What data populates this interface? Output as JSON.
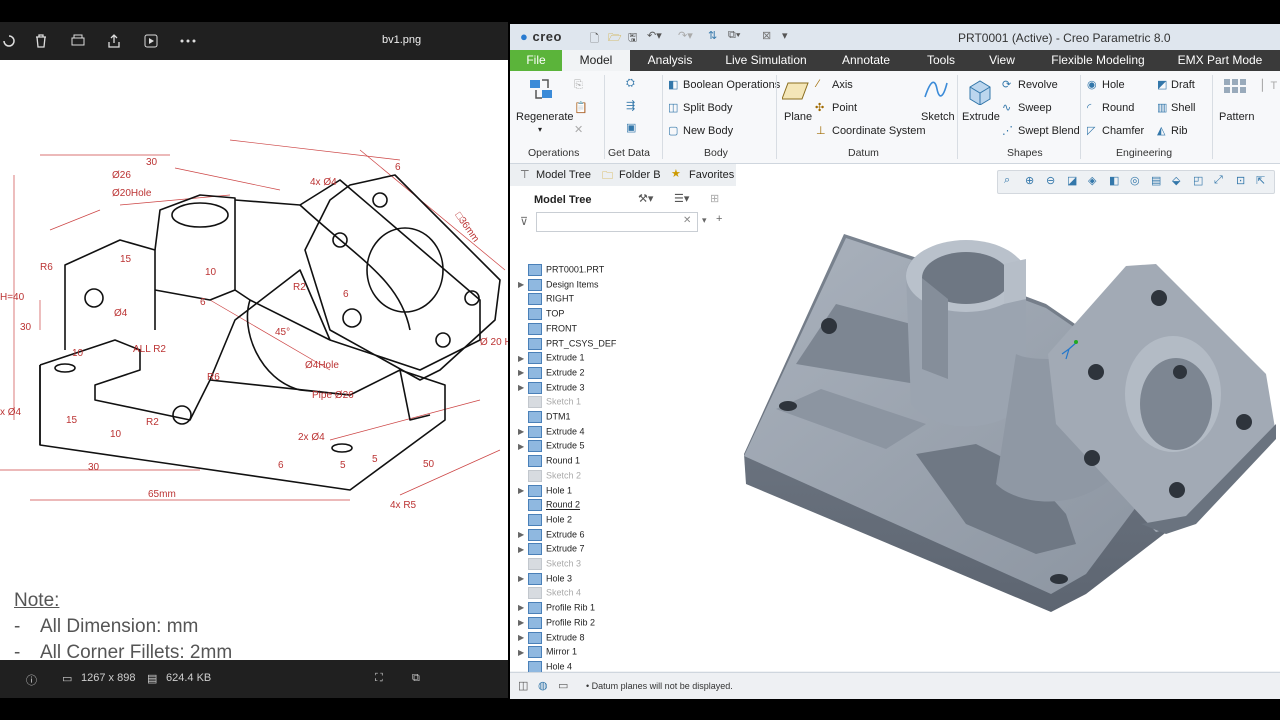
{
  "viewer": {
    "title": "bv1.png",
    "dimensions": "1267 x 898",
    "filesize": "624.4 KB",
    "note_title": "Note:",
    "notes": [
      "All Dimension: mm",
      "All Corner Fillets: 2mm"
    ],
    "drawing_labels": {
      "d30": "30",
      "d26": "Ø26",
      "d20hole": "Ø20Hole",
      "r6a": "R6",
      "d15": "15",
      "d10a": "10",
      "d4a": "4x Ø4",
      "r2": "R2",
      "h40": "H=40",
      "d30b": "30",
      "d4b": "Ø4",
      "d6": "6",
      "allr2": "ALL R2",
      "d10b": "10",
      "r6b": "R6",
      "d45": "45°",
      "d4hole": "Ø4Hole",
      "pipe": "Pipe Ø26",
      "d36": "□36mm",
      "d20r": "Ø 20 H",
      "x4": "x Ø4",
      "d15b": "15",
      "d10c": "10",
      "r2b": "R2",
      "d2x4": "2x Ø4",
      "d6b": "6",
      "d5": "5",
      "d5b": "5",
      "d30c": "30",
      "d65": "65mm",
      "d50": "50",
      "r5": "4x R5",
      "d6c": "6",
      "d6d": "6"
    }
  },
  "creo": {
    "window_title": "PRT0001 (Active) - Creo Parametric 8.0",
    "logo": "creo",
    "tabs": [
      "File",
      "Model",
      "Analysis",
      "Live Simulation",
      "Annotate",
      "Tools",
      "View",
      "Flexible Modeling",
      "EMX Part Mode"
    ],
    "ribbon": {
      "regenerate": "Regenerate",
      "boolean": "Boolean Operations",
      "split": "Split Body",
      "newbody": "New Body",
      "plane": "Plane",
      "axis": "Axis",
      "point": "Point",
      "csys": "Coordinate System",
      "sketch": "Sketch",
      "extrude": "Extrude",
      "revolve": "Revolve",
      "sweep": "Sweep",
      "sweptblend": "Swept Blend",
      "hole": "Hole",
      "round": "Round",
      "chamfer": "Chamfer",
      "draft": "Draft",
      "shell": "Shell",
      "rib": "Rib",
      "pattern": "Pattern",
      "groups": [
        "Operations",
        "Get Data",
        "Body",
        "Datum",
        "Shapes",
        "Engineering"
      ]
    },
    "panel_tabs": [
      "Model Tree",
      "Folder B",
      "Favorites"
    ],
    "tree_title": "Model Tree",
    "tree_items": [
      {
        "label": "PRT0001.PRT",
        "exp": "",
        "dim": false,
        "ul": false
      },
      {
        "label": "Design Items",
        "exp": "▶",
        "dim": false,
        "ul": false
      },
      {
        "label": "RIGHT",
        "exp": "",
        "dim": false,
        "ul": false
      },
      {
        "label": "TOP",
        "exp": "",
        "dim": false,
        "ul": false
      },
      {
        "label": "FRONT",
        "exp": "",
        "dim": false,
        "ul": false
      },
      {
        "label": "PRT_CSYS_DEF",
        "exp": "",
        "dim": false,
        "ul": false
      },
      {
        "label": "Extrude 1",
        "exp": "▶",
        "dim": false,
        "ul": false
      },
      {
        "label": "Extrude 2",
        "exp": "▶",
        "dim": false,
        "ul": false
      },
      {
        "label": "Extrude 3",
        "exp": "▶",
        "dim": false,
        "ul": false
      },
      {
        "label": "Sketch 1",
        "exp": "",
        "dim": true,
        "ul": false
      },
      {
        "label": "DTM1",
        "exp": "",
        "dim": false,
        "ul": false
      },
      {
        "label": "Extrude 4",
        "exp": "▶",
        "dim": false,
        "ul": false
      },
      {
        "label": "Extrude 5",
        "exp": "▶",
        "dim": false,
        "ul": false
      },
      {
        "label": "Round 1",
        "exp": "",
        "dim": false,
        "ul": false
      },
      {
        "label": "Sketch 2",
        "exp": "",
        "dim": true,
        "ul": false
      },
      {
        "label": "Hole 1",
        "exp": "▶",
        "dim": false,
        "ul": false
      },
      {
        "label": "Round 2",
        "exp": "",
        "dim": false,
        "ul": true
      },
      {
        "label": "Hole 2",
        "exp": "",
        "dim": false,
        "ul": false
      },
      {
        "label": "Extrude 6",
        "exp": "▶",
        "dim": false,
        "ul": false
      },
      {
        "label": "Extrude 7",
        "exp": "▶",
        "dim": false,
        "ul": false
      },
      {
        "label": "Sketch 3",
        "exp": "",
        "dim": true,
        "ul": false
      },
      {
        "label": "Hole 3",
        "exp": "▶",
        "dim": false,
        "ul": false
      },
      {
        "label": "Sketch 4",
        "exp": "",
        "dim": true,
        "ul": false
      },
      {
        "label": "Profile Rib 1",
        "exp": "▶",
        "dim": false,
        "ul": false
      },
      {
        "label": "Profile Rib 2",
        "exp": "▶",
        "dim": false,
        "ul": false
      },
      {
        "label": "Extrude 8",
        "exp": "▶",
        "dim": false,
        "ul": false
      },
      {
        "label": "Mirror 1",
        "exp": "▶",
        "dim": false,
        "ul": false
      },
      {
        "label": "Hole 4",
        "exp": "",
        "dim": false,
        "ul": false
      }
    ],
    "status_message": "Datum planes will not be displayed.",
    "colors": {
      "file_tab": "#5bb43a",
      "ribbon_dark": "#3a3a3a",
      "model_gray": "#8e97a3"
    }
  }
}
